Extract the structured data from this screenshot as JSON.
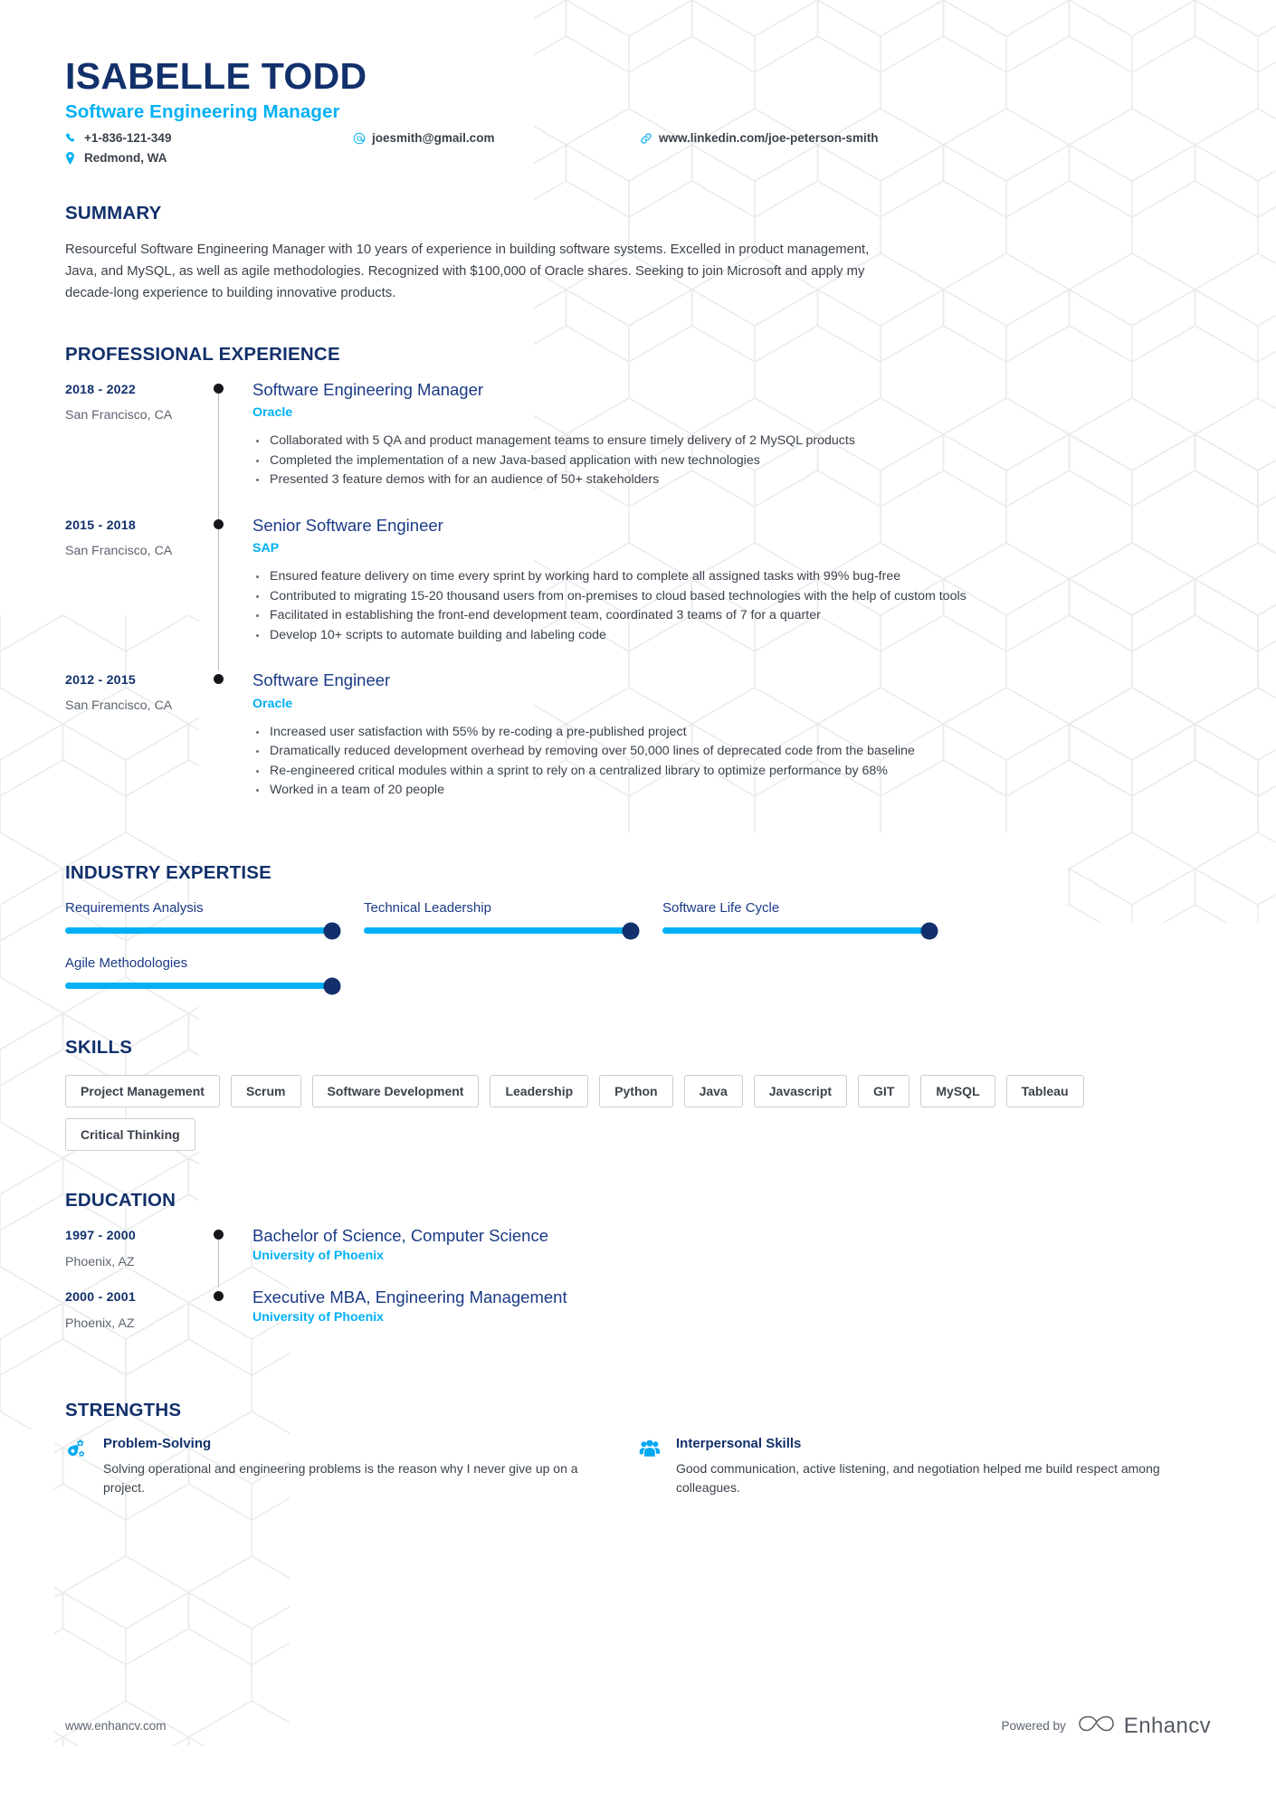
{
  "header": {
    "name": "ISABELLE TODD",
    "job_title": "Software Engineering Manager",
    "contacts": {
      "phone": "+1-836-121-349",
      "location": "Redmond, WA",
      "email": "joesmith@gmail.com",
      "linkedin": "www.linkedin.com/joe-peterson-smith"
    }
  },
  "colors": {
    "navy": "#12306b",
    "accent_blue": "#00b0f5",
    "role_blue": "#1a3a86",
    "body_text": "#3b424c"
  },
  "summary": {
    "title": "SUMMARY",
    "text": "Resourceful Software Engineering Manager with 10 years of experience in building software systems. Excelled in product management, Java, and MySQL, as well as agile methodologies. Recognized with $100,000 of Oracle shares. Seeking to join Microsoft and apply my decade-long experience to building innovative products."
  },
  "experience": {
    "title": "PROFESSIONAL EXPERIENCE",
    "items": [
      {
        "dates": "2018 - 2022",
        "location": "San Francisco, CA",
        "role": "Software Engineering Manager",
        "company": "Oracle",
        "bullets": [
          "Collaborated with 5 QA and product management teams to ensure timely delivery of 2 MySQL products",
          "Completed the implementation of a new Java-based application with new technologies",
          "Presented 3 feature demos with for an audience of 50+ stakeholders"
        ]
      },
      {
        "dates": "2015 - 2018",
        "location": "San Francisco, CA",
        "role": "Senior Software Engineer",
        "company": "SAP",
        "bullets": [
          "Ensured feature delivery on time every sprint by working hard to complete all assigned tasks with 99% bug-free",
          "Contributed to migrating 15-20 thousand users from on-premises to cloud based technologies with the help of custom tools",
          "Facilitated in establishing the front-end development team, coordinated 3 teams of 7 for a quarter",
          "Develop 10+ scripts to automate building and labeling code"
        ]
      },
      {
        "dates": "2012 - 2015",
        "location": "San Francisco, CA",
        "role": "Software Engineer",
        "company": "Oracle",
        "bullets": [
          "Increased user satisfaction with 55% by re-coding a pre-published project",
          "Dramatically reduced development overhead by removing over 50,000 lines of deprecated code from the baseline",
          "Re-engineered critical modules within a sprint to rely on a centralized library to optimize performance by 68%",
          "Worked in a team of 20 people"
        ]
      }
    ]
  },
  "expertise": {
    "title": "INDUSTRY EXPERTISE",
    "items": [
      {
        "label": "Requirements Analysis",
        "value": 100
      },
      {
        "label": "Technical Leadership",
        "value": 100
      },
      {
        "label": "Software Life Cycle",
        "value": 100
      },
      {
        "label": "Agile Methodologies",
        "value": 100
      }
    ]
  },
  "skills": {
    "title": "SKILLS",
    "tags": [
      "Project Management",
      "Scrum",
      "Software Development",
      "Leadership",
      "Python",
      "Java",
      "Javascript",
      "GIT",
      "MySQL",
      "Tableau",
      "Critical Thinking"
    ]
  },
  "education": {
    "title": "EDUCATION",
    "items": [
      {
        "dates": "1997 - 2000",
        "location": "Phoenix, AZ",
        "degree": "Bachelor of Science, Computer Science",
        "school": "University of Phoenix"
      },
      {
        "dates": "2000 - 2001",
        "location": "Phoenix, AZ",
        "degree": "Executive MBA, Engineering Management",
        "school": "University of Phoenix"
      }
    ]
  },
  "strengths": {
    "title": "STRENGTHS",
    "items": [
      {
        "icon": "gears-icon",
        "title": "Problem-Solving",
        "text": "Solving operational and engineering problems is the reason why I never give up on a project."
      },
      {
        "icon": "people-icon",
        "title": "Interpersonal Skills",
        "text": "Good communication, active listening, and negotiation helped me build respect among colleagues."
      }
    ]
  },
  "footer": {
    "url": "www.enhancv.com",
    "powered_by": "Powered by",
    "brand": "Enhancv"
  }
}
